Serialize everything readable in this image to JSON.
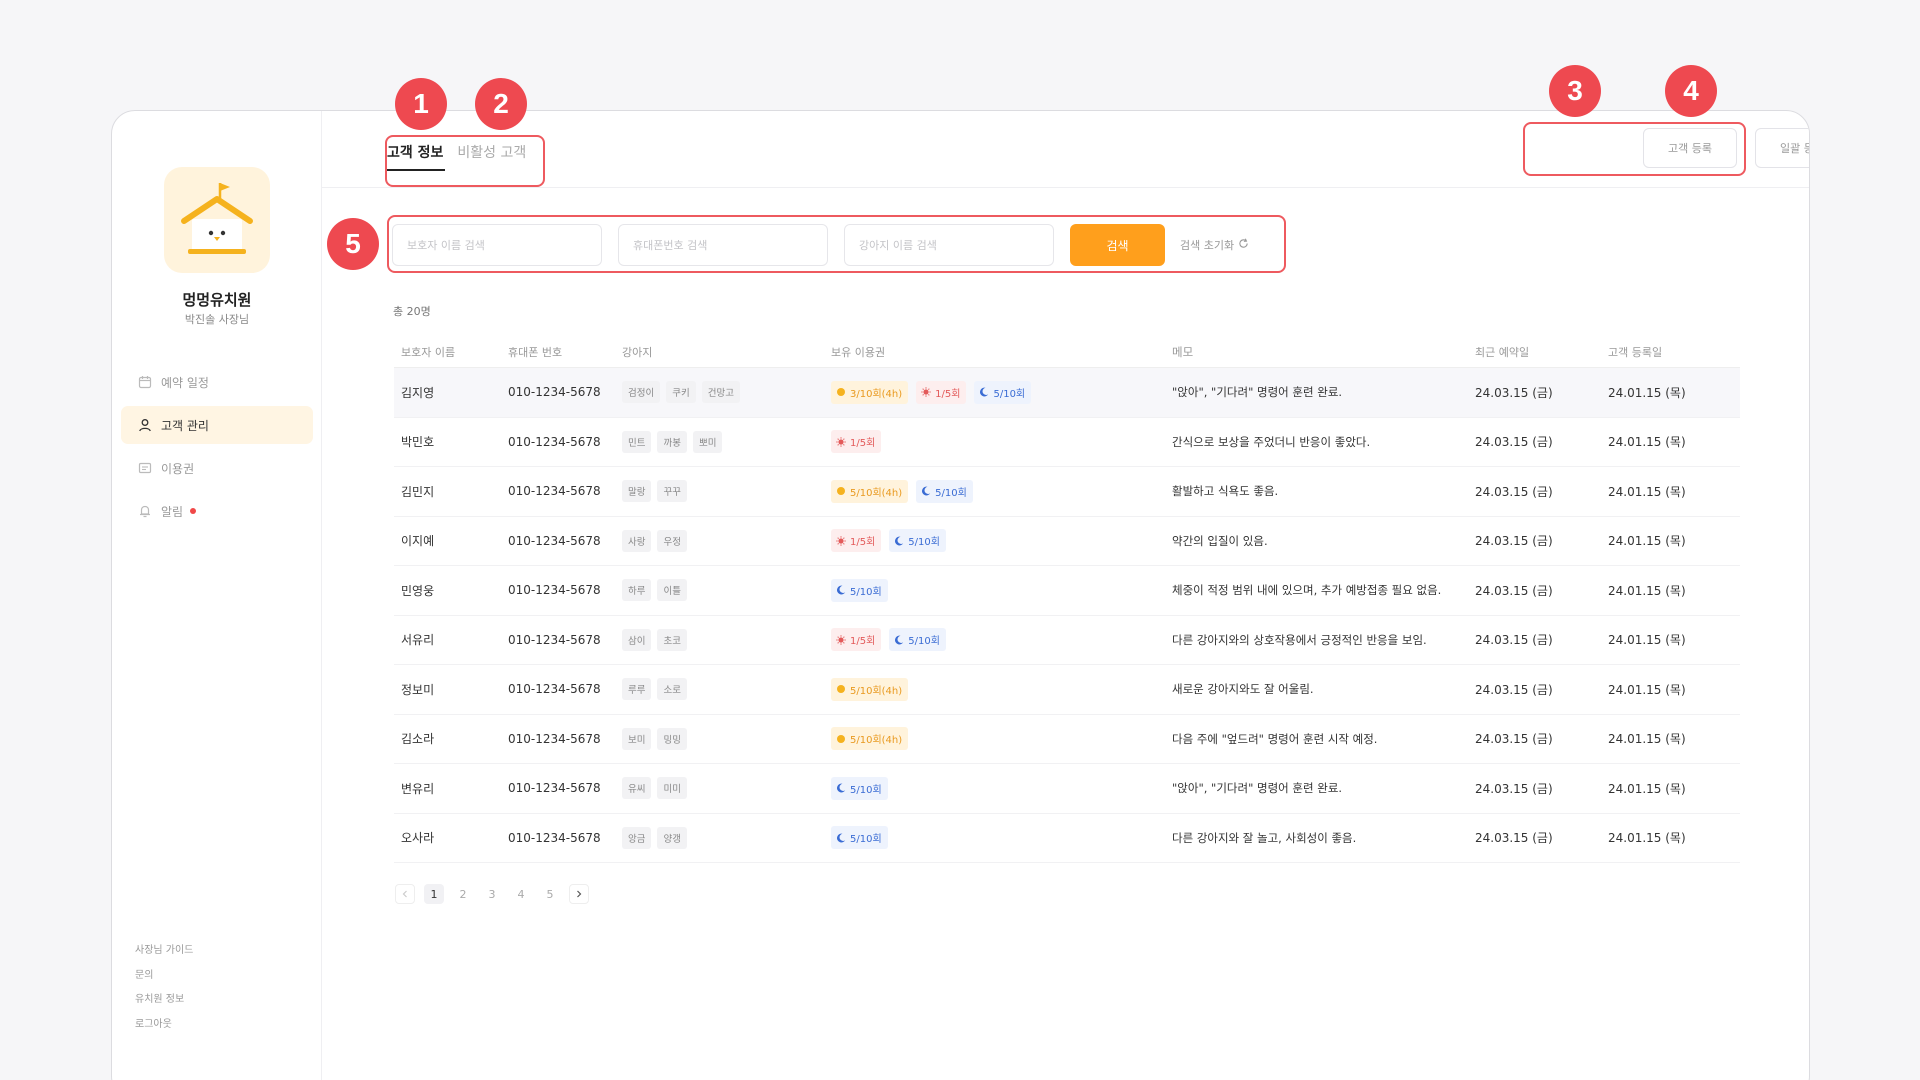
{
  "brand": {
    "name": "멍멍유치원",
    "owner": "박진솔 사장님"
  },
  "nav": [
    {
      "label": "예약 일정",
      "icon": "calendar-icon"
    },
    {
      "label": "고객 관리",
      "icon": "user-icon",
      "active": true
    },
    {
      "label": "이용권",
      "icon": "ticket-icon"
    },
    {
      "label": "알림",
      "icon": "bell-icon",
      "dot": true
    }
  ],
  "footer_links": [
    "사장님 가이드",
    "문의",
    "유치원 정보",
    "로그아웃"
  ],
  "tabs": [
    {
      "label": "고객 정보",
      "active": true
    },
    {
      "label": "비활성 고객"
    }
  ],
  "header_buttons": {
    "register": "고객 등록",
    "bulk_register": "일괄 등록"
  },
  "search": {
    "guardian_placeholder": "보호자 이름 검색",
    "phone_placeholder": "휴대폰번호 검색",
    "dog_placeholder": "강아지 이름 검색",
    "button": "검색",
    "reset": "검색 초기화"
  },
  "total": "총 20명",
  "columns": [
    "보호자 이름",
    "휴대폰 번호",
    "강아지",
    "보유 이용권",
    "메모",
    "최근 예약일",
    "고객 등록일"
  ],
  "rows": [
    {
      "name": "김지영",
      "phone": "010-1234-5678",
      "dogs": [
        "검정이",
        "쿠키",
        "건망고"
      ],
      "tickets": [
        {
          "type": "sun",
          "label": "3/10회(4h)"
        },
        {
          "type": "day",
          "label": "1/5회"
        },
        {
          "type": "moon",
          "label": "5/10회"
        }
      ],
      "memo": "\"앉아\", \"기다려\" 명령어 훈련 완료.",
      "recent": "24.03.15 (금)",
      "registered": "24.01.15 (목)"
    },
    {
      "name": "박민호",
      "phone": "010-1234-5678",
      "dogs": [
        "민트",
        "까봉",
        "뽀미"
      ],
      "tickets": [
        {
          "type": "day",
          "label": "1/5회"
        }
      ],
      "memo": "간식으로 보상을 주었더니 반응이 좋았다.",
      "recent": "24.03.15 (금)",
      "registered": "24.01.15 (목)"
    },
    {
      "name": "김민지",
      "phone": "010-1234-5678",
      "dogs": [
        "말랑",
        "꾸꾸"
      ],
      "tickets": [
        {
          "type": "sun",
          "label": "5/10회(4h)"
        },
        {
          "type": "moon",
          "label": "5/10회"
        }
      ],
      "memo": "활발하고 식욕도 좋음.",
      "recent": "24.03.15 (금)",
      "registered": "24.01.15 (목)"
    },
    {
      "name": "이지예",
      "phone": "010-1234-5678",
      "dogs": [
        "사랑",
        "우정"
      ],
      "tickets": [
        {
          "type": "day",
          "label": "1/5회"
        },
        {
          "type": "moon",
          "label": "5/10회"
        }
      ],
      "memo": "약간의 입질이 있음.",
      "recent": "24.03.15 (금)",
      "registered": "24.01.15 (목)"
    },
    {
      "name": "민영웅",
      "phone": "010-1234-5678",
      "dogs": [
        "하루",
        "이틀"
      ],
      "tickets": [
        {
          "type": "moon",
          "label": "5/10회"
        }
      ],
      "memo": "체중이 적정 범위 내에 있으며, 추가 예방접종 필요 없음.",
      "recent": "24.03.15 (금)",
      "registered": "24.01.15 (목)"
    },
    {
      "name": "서유리",
      "phone": "010-1234-5678",
      "dogs": [
        "삼이",
        "초코"
      ],
      "tickets": [
        {
          "type": "day",
          "label": "1/5회"
        },
        {
          "type": "moon",
          "label": "5/10회"
        }
      ],
      "memo": "다른 강아지와의 상호작용에서 긍정적인 반응을 보임.",
      "recent": "24.03.15 (금)",
      "registered": "24.01.15 (목)"
    },
    {
      "name": "정보미",
      "phone": "010-1234-5678",
      "dogs": [
        "루루",
        "소로"
      ],
      "tickets": [
        {
          "type": "sun",
          "label": "5/10회(4h)"
        }
      ],
      "memo": "새로운 강아지와도 잘 어울림.",
      "recent": "24.03.15 (금)",
      "registered": "24.01.15 (목)"
    },
    {
      "name": "김소라",
      "phone": "010-1234-5678",
      "dogs": [
        "보미",
        "밍밍"
      ],
      "tickets": [
        {
          "type": "sun",
          "label": "5/10회(4h)"
        }
      ],
      "memo": "다음 주에 \"엎드려\" 명령어 훈련 시작 예정.",
      "recent": "24.03.15 (금)",
      "registered": "24.01.15 (목)"
    },
    {
      "name": "변유리",
      "phone": "010-1234-5678",
      "dogs": [
        "유씨",
        "미미"
      ],
      "tickets": [
        {
          "type": "moon",
          "label": "5/10회"
        }
      ],
      "memo": "\"앉아\", \"기다려\" 명령어 훈련 완료.",
      "recent": "24.03.15 (금)",
      "registered": "24.01.15 (목)"
    },
    {
      "name": "오사라",
      "phone": "010-1234-5678",
      "dogs": [
        "앙금",
        "양갱"
      ],
      "tickets": [
        {
          "type": "moon",
          "label": "5/10회"
        }
      ],
      "memo": "다른 강아지와 잘 놀고, 사회성이 좋음.",
      "recent": "24.03.15 (금)",
      "registered": "24.01.15 (목)"
    }
  ],
  "pagination": {
    "pages": [
      "1",
      "2",
      "3",
      "4",
      "5"
    ],
    "current": "1"
  },
  "annotations": [
    "1",
    "2",
    "3",
    "4",
    "5"
  ],
  "colors": {
    "accent": "#ff9f1c",
    "annotation": "#ee4950",
    "active_nav_bg": "#fff5e3"
  }
}
